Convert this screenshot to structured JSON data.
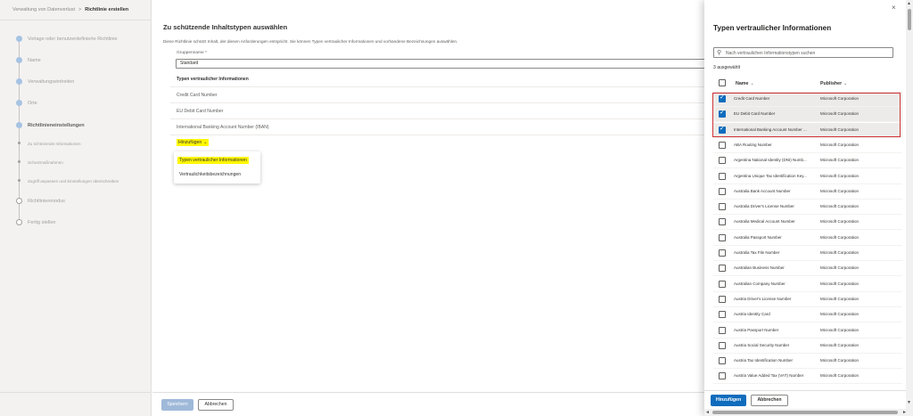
{
  "breadcrumb": {
    "parent": "Verwaltung von Datenverlust",
    "separator": ">",
    "current": "Richtlinie erstellen"
  },
  "wizard": {
    "steps": [
      {
        "label": "Vorlage oder benutzerdefinierte Richtlinie",
        "state": "done"
      },
      {
        "label": "Name",
        "state": "done"
      },
      {
        "label": "Verwaltungseinheiten",
        "state": "done"
      },
      {
        "label": "Orte",
        "state": "done"
      },
      {
        "label": "Richtlinieneinstellungen",
        "state": "current"
      },
      {
        "label": "Zu schützende Informationen",
        "state": "sub"
      },
      {
        "label": "Schutzmaßnahmen",
        "state": "sub"
      },
      {
        "label": "Zugriff anpassen und Einstellungen überschreiben",
        "state": "sub"
      },
      {
        "label": "Richtlinienmodus",
        "state": "todo"
      },
      {
        "label": "Fertig stellen",
        "state": "todo"
      }
    ]
  },
  "main": {
    "title": "Zu schützende Inhaltstypen auswählen",
    "description": "Diese Richtlinie schützt Inhalt, der diesen Anforderungen entspricht. Sie können Typen vertraulicher Informationen und vorhandene Bezeichnungen auswählen.",
    "group_label": "Gruppenname *",
    "group_value": "Standard",
    "table_header": "Typen vertraulicher Informationen",
    "rows": [
      "Credit Card Number",
      "EU Debit Card Number",
      "International Banking Account Number (IBAN)"
    ],
    "add_label": "Hinzufügen",
    "add_chevron": "⌄",
    "dropdown": [
      "Typen vertraulicher Informationen",
      "Vertraulichkeitsbezeichnungen"
    ],
    "save_label": "Speichern",
    "cancel_label": "Abbrechen"
  },
  "panel": {
    "close_icon": "×",
    "title": "Typen vertraulicher Informationen",
    "search_placeholder": "Nach vertraulichen Informationstypen suchen",
    "selected_count": "3 ausgewählt",
    "col_name": "Name",
    "col_publisher": "Publisher",
    "col_chevron": "⌄",
    "items": [
      {
        "name": "Credit Card Number",
        "publisher": "Microsoft Corporation",
        "checked": true
      },
      {
        "name": "EU Debit Card Number",
        "publisher": "Microsoft Corporation",
        "checked": true
      },
      {
        "name": "International Banking Account Number ...",
        "publisher": "Microsoft Corporation",
        "checked": true
      },
      {
        "name": "ABA Routing Number",
        "publisher": "Microsoft Corporation",
        "checked": false
      },
      {
        "name": "Argentina National Identity (DNI) Numb...",
        "publisher": "Microsoft Corporation",
        "checked": false
      },
      {
        "name": "Argentina Unique Tax Identification Key...",
        "publisher": "Microsoft Corporation",
        "checked": false
      },
      {
        "name": "Australia Bank Account Number",
        "publisher": "Microsoft Corporation",
        "checked": false
      },
      {
        "name": "Australia Driver's License Number",
        "publisher": "Microsoft Corporation",
        "checked": false
      },
      {
        "name": "Australia Medical Account Number",
        "publisher": "Microsoft Corporation",
        "checked": false
      },
      {
        "name": "Australia Passport Number",
        "publisher": "Microsoft Corporation",
        "checked": false
      },
      {
        "name": "Australia Tax File Number",
        "publisher": "Microsoft Corporation",
        "checked": false
      },
      {
        "name": "Australian Business Number",
        "publisher": "Microsoft Corporation",
        "checked": false
      },
      {
        "name": "Australian Company Number",
        "publisher": "Microsoft Corporation",
        "checked": false
      },
      {
        "name": "Austria Driver's License Number",
        "publisher": "Microsoft Corporation",
        "checked": false
      },
      {
        "name": "Austria Identity Card",
        "publisher": "Microsoft Corporation",
        "checked": false
      },
      {
        "name": "Austria Passport Number",
        "publisher": "Microsoft Corporation",
        "checked": false
      },
      {
        "name": "Austria Social Security Number",
        "publisher": "Microsoft Corporation",
        "checked": false
      },
      {
        "name": "Austria Tax Identification Number",
        "publisher": "Microsoft Corporation",
        "checked": false
      },
      {
        "name": "Austria Value Added Tax (VAT) Number",
        "publisher": "Microsoft Corporation",
        "checked": false
      }
    ],
    "add_label": "Hinzufügen",
    "cancel_label": "Abbrechen"
  },
  "scrollbars": {
    "up_icon": "▲",
    "down_icon": "▼",
    "left_icon": "◄",
    "right_icon": "►"
  },
  "colors": {
    "accent": "#0f6cbd",
    "highlight": "#fff700",
    "annotation_red": "#d13438"
  }
}
